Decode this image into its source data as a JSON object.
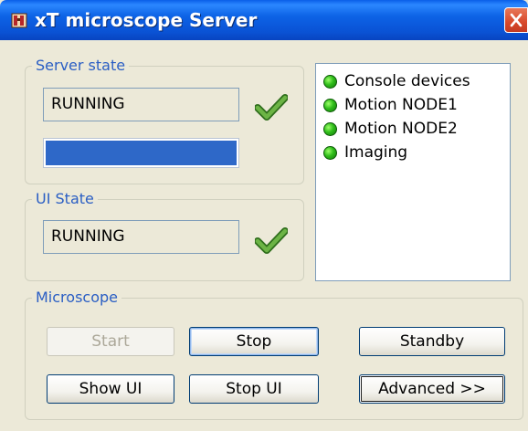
{
  "window": {
    "title": "xT microscope Server"
  },
  "server_state": {
    "label": "Server state",
    "status": "RUNNING",
    "progress": 1.0,
    "check_icon": "checkmark-icon"
  },
  "ui_state": {
    "label": "UI State",
    "status": "RUNNING",
    "check_icon": "checkmark-icon"
  },
  "devices": [
    {
      "label": "Console devices",
      "status_color": "#2fbd1a"
    },
    {
      "label": "Motion NODE1",
      "status_color": "#2fbd1a"
    },
    {
      "label": "Motion NODE2",
      "status_color": "#2fbd1a"
    },
    {
      "label": "Imaging",
      "status_color": "#2fbd1a"
    }
  ],
  "microscope": {
    "label": "Microscope",
    "buttons": {
      "start": "Start",
      "stop": "Stop",
      "standby": "Standby",
      "show_ui": "Show UI",
      "stop_ui": "Stop UI",
      "advanced": "Advanced >>"
    }
  },
  "colors": {
    "accent": "#2a5ec4",
    "titlebar": "#0a52d4",
    "progress": "#2e68c8",
    "check": "#4a9a2c"
  }
}
